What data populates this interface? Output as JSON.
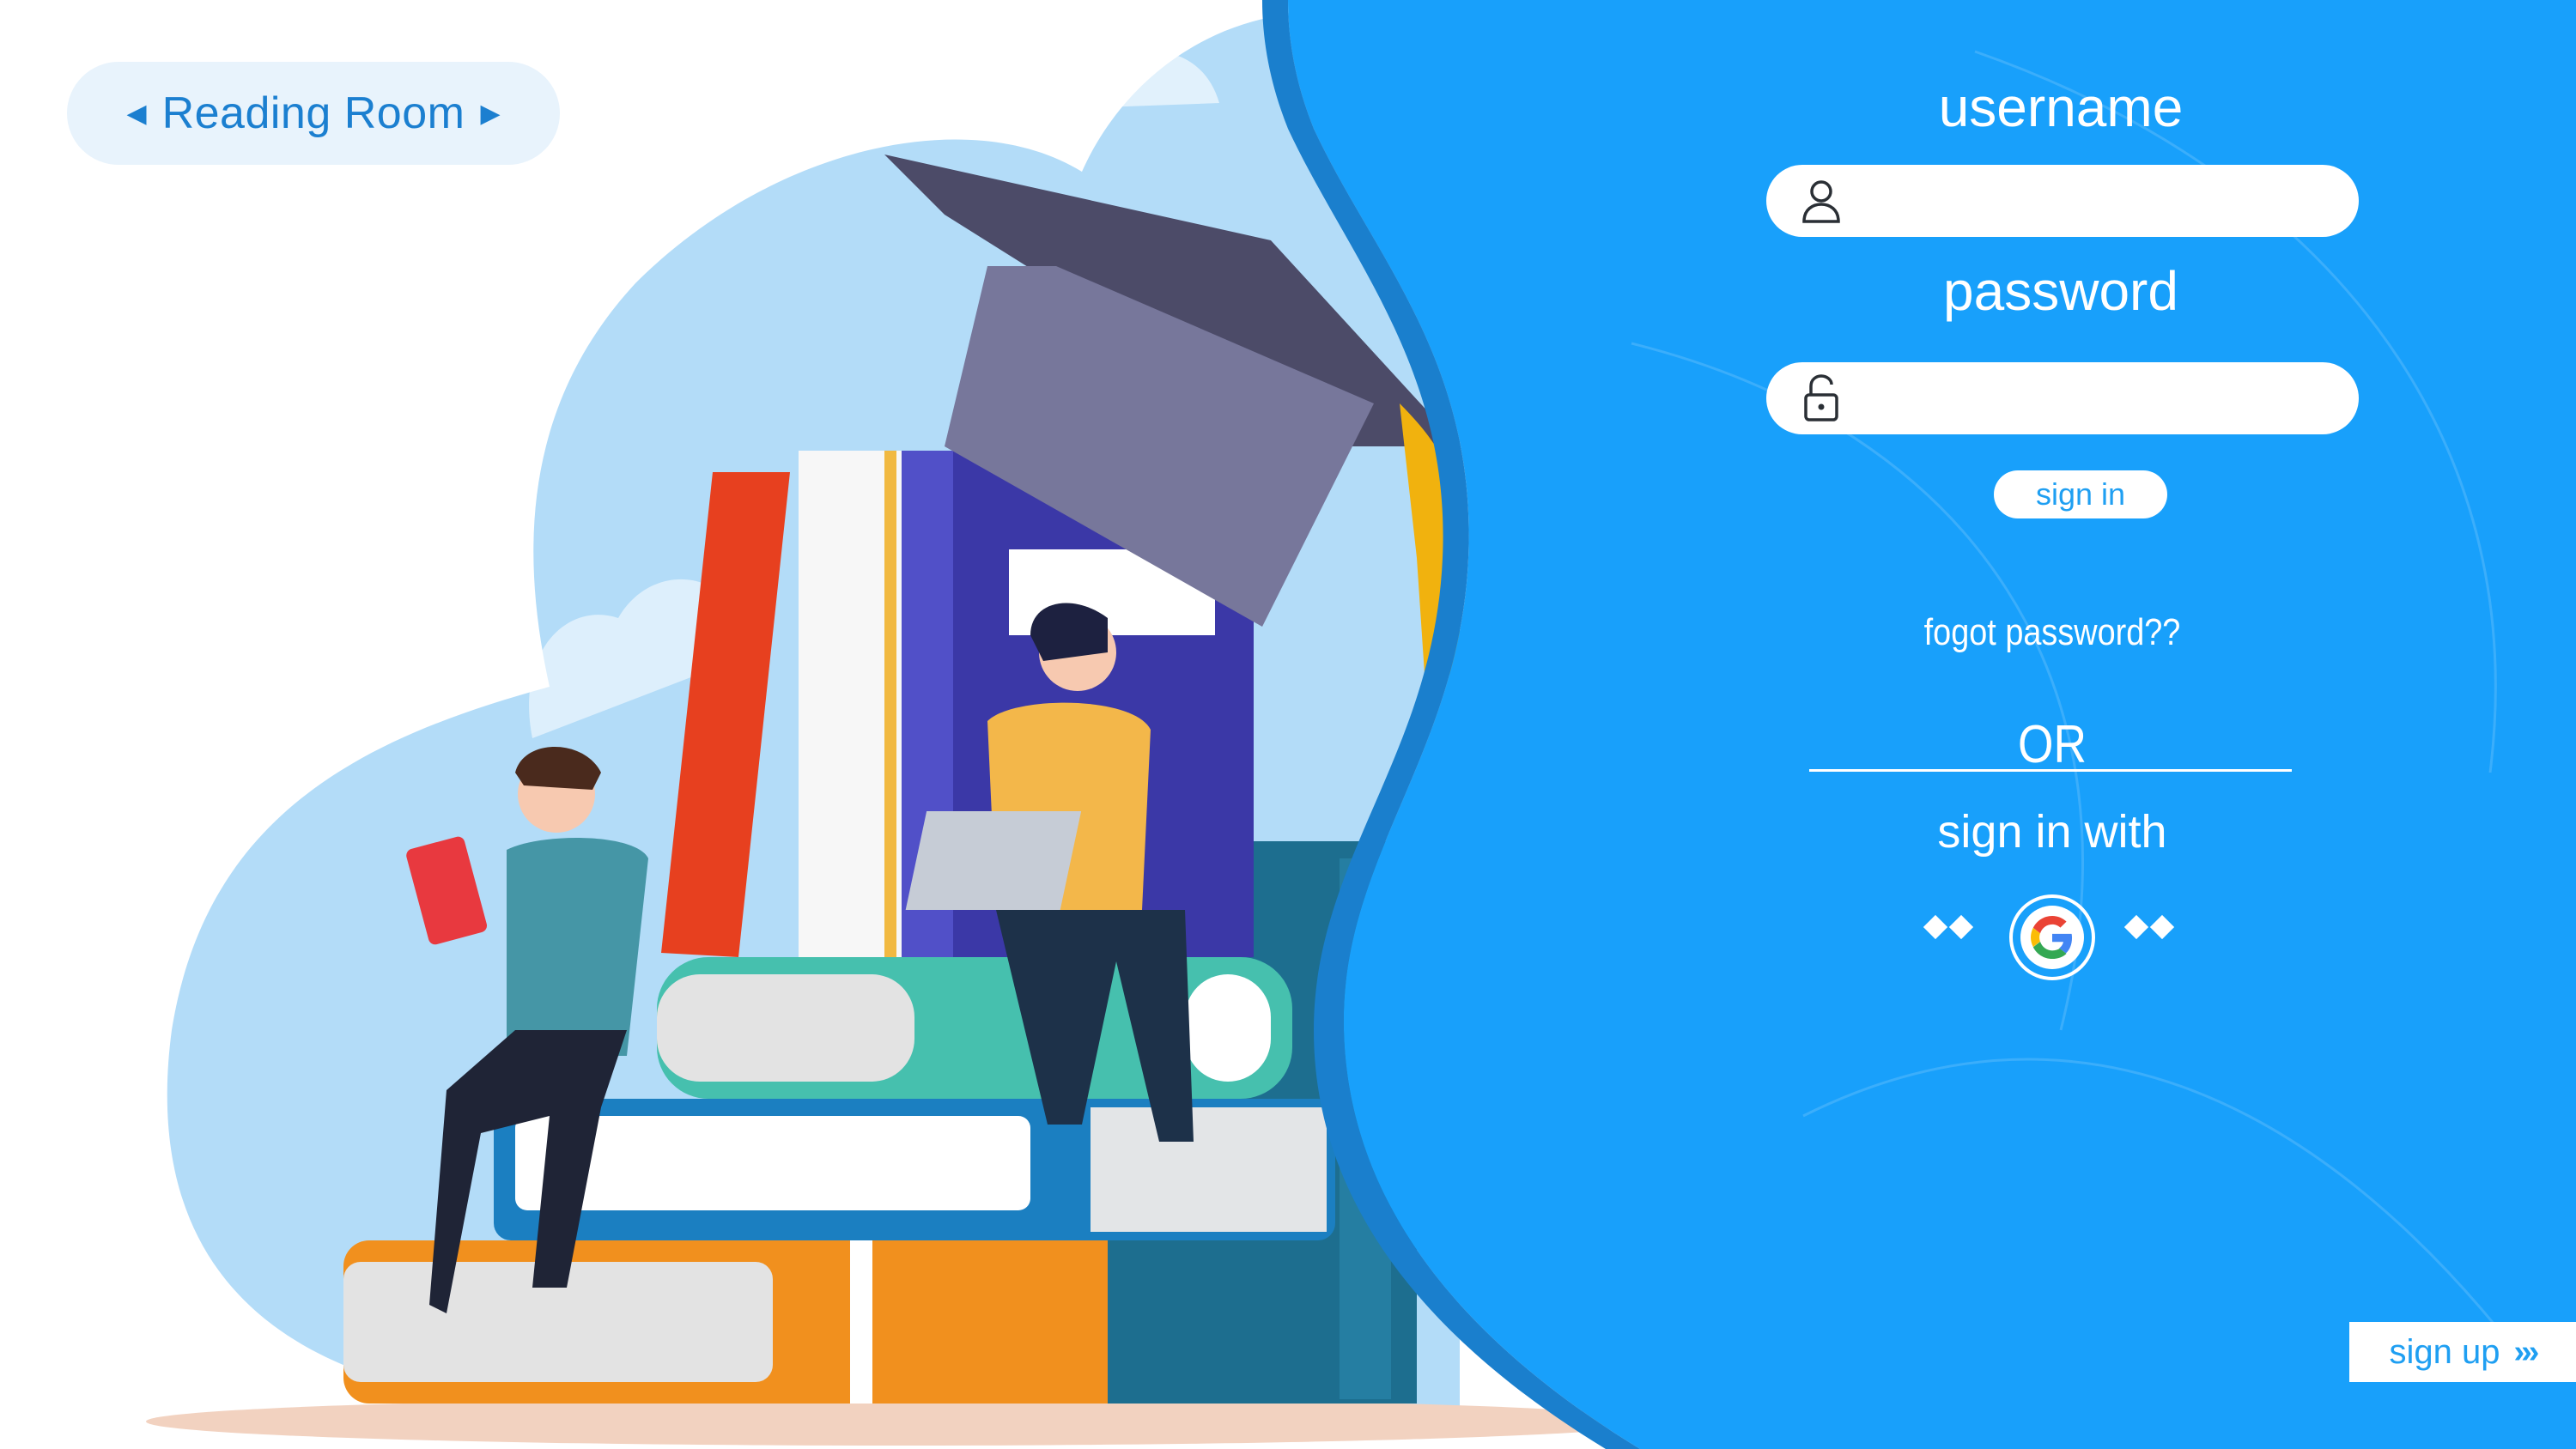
{
  "brand": {
    "name": "Reading Room",
    "left_arrow_icon": "caret-left-icon",
    "right_arrow_icon": "caret-right-icon"
  },
  "login": {
    "username_label": "username",
    "username_value": "",
    "username_icon": "user-icon",
    "password_label": "password",
    "password_value": "",
    "password_icon": "padlock-icon",
    "signin_label": "sign in",
    "forgot_label": "fogot password??",
    "or_label": "OR",
    "signin_with_label": "sign in with",
    "google_icon": "google-icon",
    "signup_label": "sign up",
    "signup_icon": "triple-chevron-right-icon"
  },
  "colors": {
    "panel_blue": "#18a0fb",
    "brand_text": "#1b7fd0",
    "sky": "#b3dcf8"
  }
}
